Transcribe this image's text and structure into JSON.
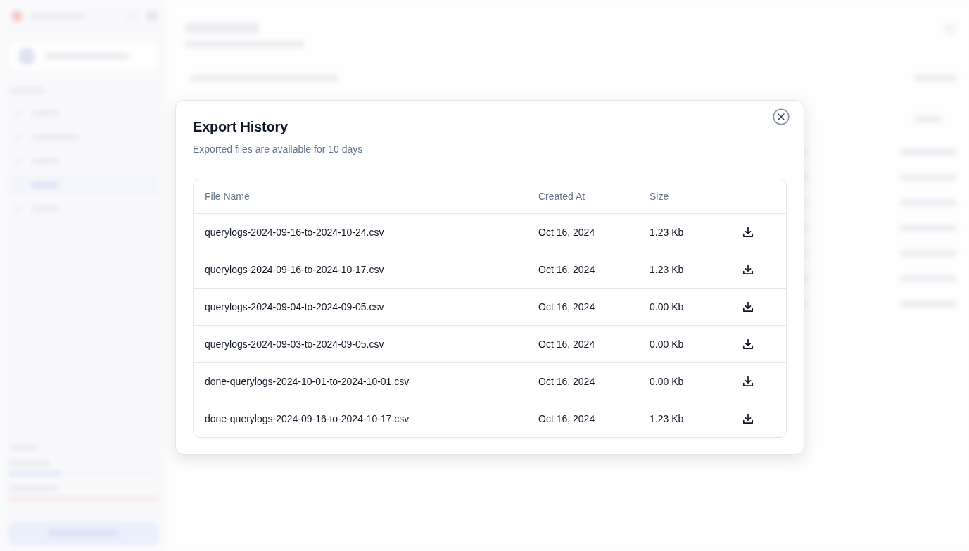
{
  "dialog": {
    "title": "Export History",
    "subtitle": "Exported files are available for 10 days"
  },
  "table": {
    "columns": [
      "File Name",
      "Created At",
      "Size"
    ],
    "rows": [
      {
        "file_name": "querylogs-2024-09-16-to-2024-10-24.csv",
        "created_at": "Oct 16, 2024",
        "size": "1.23 Kb"
      },
      {
        "file_name": "querylogs-2024-09-16-to-2024-10-17.csv",
        "created_at": "Oct 16, 2024",
        "size": "1.23 Kb"
      },
      {
        "file_name": "querylogs-2024-09-04-to-2024-09-05.csv",
        "created_at": "Oct 16, 2024",
        "size": "0.00 Kb"
      },
      {
        "file_name": "querylogs-2024-09-03-to-2024-09-05.csv",
        "created_at": "Oct 16, 2024",
        "size": "0.00 Kb"
      },
      {
        "file_name": "done-querylogs-2024-10-01-to-2024-10-01.csv",
        "created_at": "Oct 16, 2024",
        "size": "0.00 Kb"
      },
      {
        "file_name": "done-querylogs-2024-09-16-to-2024-10-17.csv",
        "created_at": "Oct 16, 2024",
        "size": "1.23 Kb"
      }
    ]
  }
}
